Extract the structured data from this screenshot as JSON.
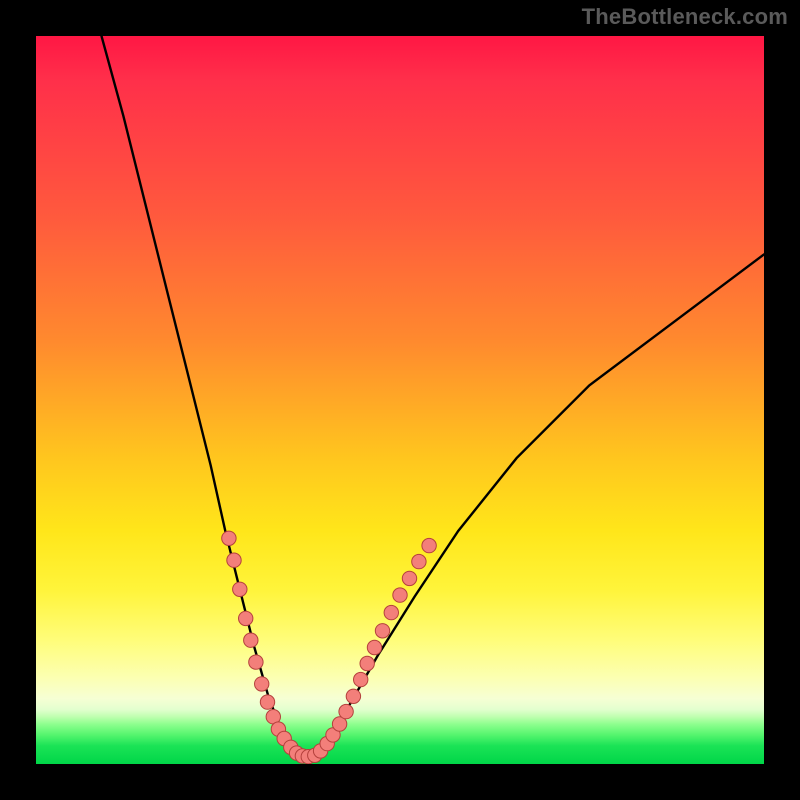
{
  "watermark": "TheBottleneck.com",
  "colors": {
    "frame": "#000000",
    "gradient_stops": [
      {
        "pct": 0,
        "color": "#ff1744"
      },
      {
        "pct": 25,
        "color": "#ff5a3d"
      },
      {
        "pct": 58,
        "color": "#ffc61e"
      },
      {
        "pct": 83,
        "color": "#fffd7a"
      },
      {
        "pct": 93,
        "color": "#e3ffcf"
      },
      {
        "pct": 100,
        "color": "#00d648"
      }
    ],
    "curve_color": "#000000",
    "dot_fill": "#f37f7a",
    "dot_stroke": "#b4403c"
  },
  "chart_data": {
    "type": "line",
    "title": "",
    "xlabel": "",
    "ylabel": "",
    "xlim": [
      0,
      100
    ],
    "ylim": [
      0,
      100
    ],
    "grid": false,
    "series": [
      {
        "name": "bottleneck-curve",
        "_comment": "y is plotted as distance from top; minimum (best/green) occurs near x≈36. Values estimated from pixel positions because no axes are shown.",
        "x": [
          9,
          12,
          15,
          18,
          21,
          24,
          26,
          28,
          30,
          32,
          34,
          36,
          38,
          40,
          43,
          47,
          52,
          58,
          66,
          76,
          88,
          100
        ],
        "y": [
          100,
          89,
          77,
          65,
          53,
          41,
          32,
          24,
          16,
          9,
          4,
          1,
          1,
          3,
          8,
          15,
          23,
          32,
          42,
          52,
          61,
          70
        ]
      }
    ],
    "highlight_dots": {
      "_comment": "Pink dots marking the lower portion of the curve; (x,y) in same 0-100 space.",
      "points": [
        [
          26.5,
          31
        ],
        [
          27.2,
          28
        ],
        [
          28.0,
          24
        ],
        [
          28.8,
          20
        ],
        [
          29.5,
          17
        ],
        [
          30.2,
          14
        ],
        [
          31.0,
          11
        ],
        [
          31.8,
          8.5
        ],
        [
          32.6,
          6.5
        ],
        [
          33.3,
          4.8
        ],
        [
          34.1,
          3.5
        ],
        [
          35.0,
          2.3
        ],
        [
          35.8,
          1.5
        ],
        [
          36.6,
          1.1
        ],
        [
          37.4,
          1.0
        ],
        [
          38.3,
          1.2
        ],
        [
          39.1,
          1.8
        ],
        [
          40.0,
          2.8
        ],
        [
          40.8,
          4.0
        ],
        [
          41.7,
          5.5
        ],
        [
          42.6,
          7.2
        ],
        [
          43.6,
          9.3
        ],
        [
          44.6,
          11.6
        ],
        [
          45.5,
          13.8
        ],
        [
          46.5,
          16.0
        ],
        [
          47.6,
          18.3
        ],
        [
          48.8,
          20.8
        ],
        [
          50.0,
          23.2
        ],
        [
          51.3,
          25.5
        ],
        [
          52.6,
          27.8
        ],
        [
          54.0,
          30.0
        ]
      ]
    }
  }
}
